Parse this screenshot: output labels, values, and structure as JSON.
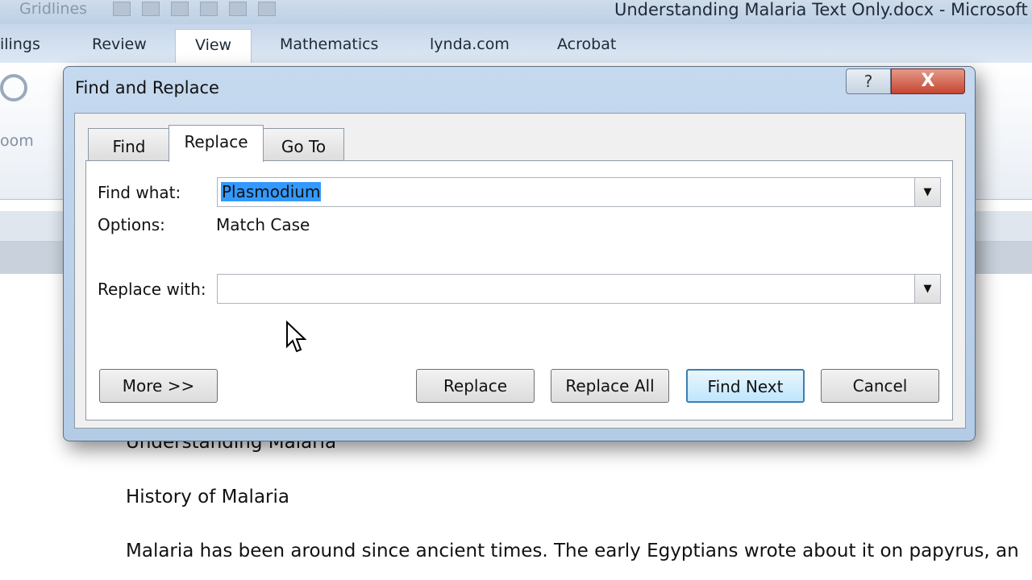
{
  "window": {
    "title": "Understanding Malaria Text Only.docx  -  Microsoft",
    "qat_label": "Gridlines"
  },
  "ribbon": {
    "tabs": [
      "ilings",
      "Review",
      "View",
      "Mathematics",
      "lynda.com",
      "Acrobat"
    ],
    "active_tab": "View",
    "zoom_label": "oom"
  },
  "dialog": {
    "title": "Find and Replace",
    "help_label": "?",
    "close_label": "X",
    "tabs": [
      "Find",
      "Replace",
      "Go To"
    ],
    "active_tab": "Replace",
    "find_label": "Find what:",
    "find_value": "Plasmodium",
    "options_label": "Options:",
    "options_value": "Match Case",
    "replace_label": "Replace with:",
    "replace_value": "",
    "buttons": {
      "more": "More >>",
      "replace": "Replace",
      "replace_all": "Replace All",
      "find_next": "Find Next",
      "cancel": "Cancel"
    }
  },
  "document": {
    "lines": [
      "Understanding Malaria",
      "History of Malaria",
      "Malaria has been around since ancient times. The early Egyptians wrote about it on papyrus, an"
    ]
  }
}
